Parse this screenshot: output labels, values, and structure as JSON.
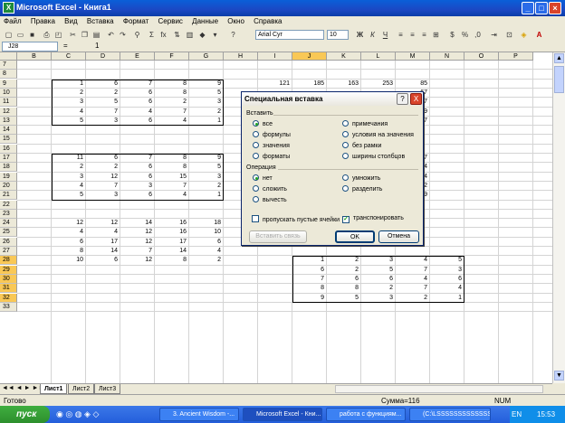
{
  "window": {
    "title": "Microsoft Excel - Книга1",
    "app_icon": "X"
  },
  "menu": [
    "Файл",
    "Правка",
    "Вид",
    "Вставка",
    "Формат",
    "Сервис",
    "Данные",
    "Окно",
    "Справка"
  ],
  "toolbar": {
    "font": "Arial Cyr",
    "size": "10",
    "sigma": "Σ",
    "fx_btn": "fx",
    "ru": "%"
  },
  "formula": {
    "cell": "J28",
    "fx": "=",
    "value": "1"
  },
  "columns": [
    "B",
    "C",
    "D",
    "E",
    "F",
    "G",
    "H",
    "I",
    "J",
    "K",
    "L",
    "M",
    "N",
    "O",
    "P"
  ],
  "rows": [
    "7",
    "8",
    "9",
    "10",
    "11",
    "12",
    "13",
    "14",
    "15",
    "16",
    "17",
    "18",
    "19",
    "20",
    "21",
    "22",
    "23",
    "24",
    "25",
    "26",
    "27",
    "28",
    "29",
    "30",
    "31",
    "32",
    "33"
  ],
  "sheet": {
    "block1": [
      [
        "1",
        "6",
        "7",
        "8",
        "9"
      ],
      [
        "2",
        "2",
        "6",
        "8",
        "5"
      ],
      [
        "3",
        "5",
        "6",
        "2",
        "3"
      ],
      [
        "4",
        "7",
        "4",
        "7",
        "2"
      ],
      [
        "5",
        "3",
        "6",
        "4",
        "1"
      ]
    ],
    "block2": [
      [
        "11",
        "6",
        "7",
        "8",
        "9"
      ],
      [
        "2",
        "2",
        "6",
        "8",
        "5"
      ],
      [
        "3",
        "12",
        "6",
        "15",
        "3"
      ],
      [
        "4",
        "7",
        "3",
        "7",
        "2"
      ],
      [
        "5",
        "3",
        "6",
        "4",
        "1"
      ]
    ],
    "block3": [
      [
        "12",
        "12",
        "14",
        "16",
        "18"
      ],
      [
        "4",
        "4",
        "12",
        "16",
        "10"
      ],
      [
        "6",
        "17",
        "12",
        "17",
        "6"
      ],
      [
        "8",
        "14",
        "7",
        "14",
        "4"
      ],
      [
        "10",
        "6",
        "12",
        "8",
        "2"
      ]
    ],
    "block4": [
      [
        "1",
        "2",
        "3",
        "4",
        "5"
      ],
      [
        "6",
        "2",
        "5",
        "7",
        "3"
      ],
      [
        "7",
        "6",
        "6",
        "4",
        "6"
      ],
      [
        "8",
        "8",
        "2",
        "7",
        "4"
      ],
      [
        "9",
        "5",
        "3",
        "2",
        "1"
      ]
    ],
    "row9_right": [
      "121",
      "185",
      "163",
      "253",
      "85"
    ],
    "m_col": [
      "67",
      "77",
      "99",
      "87"
    ],
    "m_col2": [
      "837",
      "574",
      "024",
      "082",
      "759"
    ]
  },
  "dialog": {
    "title": "Специальная вставка",
    "help": "?",
    "close": "X",
    "paste_group": "Вставить",
    "paste_left": [
      "все",
      "формулы",
      "значения",
      "форматы"
    ],
    "paste_right": [
      "примечания",
      "условия на значения",
      "без рамки",
      "ширины столбцов"
    ],
    "op_group": "Операция",
    "op_left": [
      "нет",
      "сложить",
      "вычесть"
    ],
    "op_right": [
      "умножить",
      "разделить"
    ],
    "skip_blanks": "пропускать пустые ячейки",
    "transpose": "транспонировать",
    "paste_link": "Вставить связь",
    "ok": "OK",
    "cancel": "Отмена"
  },
  "sheet_tabs": [
    "Лист1",
    "Лист2",
    "Лист3"
  ],
  "status": {
    "left": "Готово",
    "sum": "Сумма=116",
    "num": "NUM"
  },
  "taskbar": {
    "start": "пуск",
    "tasks": [
      "3. Ancient Wisdom -...",
      "Microsoft Excel - Кни...",
      "работа с функциям...",
      "(C:\\LSSSSSSSSSSSSS..."
    ],
    "lang": "EN",
    "time": "15:53"
  }
}
